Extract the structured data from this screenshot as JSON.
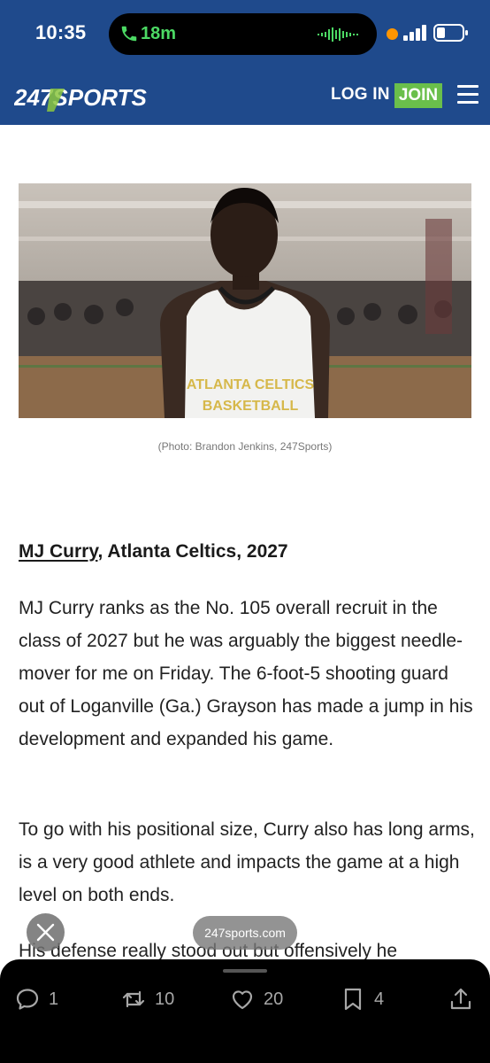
{
  "status_bar": {
    "time": "10:35",
    "call_duration": "18m",
    "icons": [
      "phone-icon",
      "audio-wave-icon",
      "recording-dot-icon",
      "signal-icon",
      "battery-icon"
    ]
  },
  "site_header": {
    "logo_text": "247SPORTS",
    "login_label": "LOG IN",
    "join_label": "JOIN",
    "menu_icon": "hamburger-menu-icon",
    "colors": {
      "header_bg": "#1f4a8c",
      "join_bg": "#6abf4b",
      "logo_accent": "#8bc53f"
    }
  },
  "article": {
    "photo_caption": "(Photo: Brandon Jenkins, 247Sports)",
    "photo_jersey_text": "ATLANTA CELTICS BASKETBALL",
    "player_link": "MJ Curry",
    "headline_rest": ", Atlanta Celtics, 2027",
    "paragraphs": [
      "MJ Curry ranks as the No. 105 overall recruit in the class of 2027 but he was arguably the biggest needle-mover for me on Friday. The 6-foot-5 shooting guard out of Loganville (Ga.) Grayson has made a jump in his development and expanded his game.",
      "To go with his positional size, Curry also has long arms, is a very good athlete and impacts the game at a high level on both ends.",
      "His defense really stood out but offensively he"
    ]
  },
  "overlay": {
    "close_icon": "close-icon",
    "url": "247sports.com"
  },
  "action_bar": {
    "replies": "1",
    "reposts": "10",
    "likes": "20",
    "bookmarks": "4",
    "icons": [
      "reply-icon",
      "repost-icon",
      "like-icon",
      "bookmark-icon",
      "share-icon"
    ]
  }
}
